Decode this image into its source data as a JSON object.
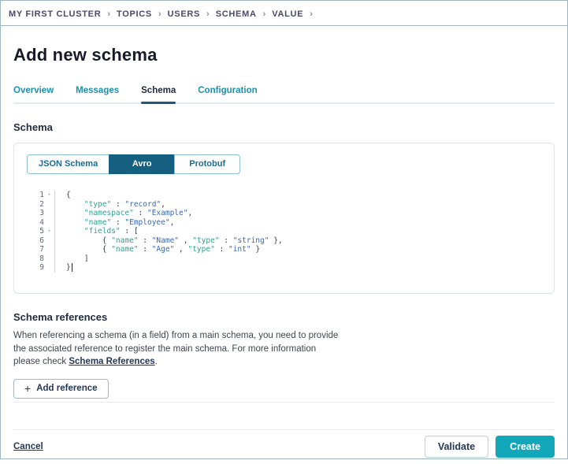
{
  "breadcrumb": {
    "separator": "›",
    "items": [
      "MY FIRST CLUSTER",
      "TOPICS",
      "USERS",
      "SCHEMA",
      "VALUE"
    ]
  },
  "page": {
    "title": "Add new schema"
  },
  "tabs": {
    "items": [
      {
        "label": "Overview",
        "active": false
      },
      {
        "label": "Messages",
        "active": false
      },
      {
        "label": "Schema",
        "active": true
      },
      {
        "label": "Configuration",
        "active": false
      }
    ]
  },
  "schema_section": {
    "heading": "Schema"
  },
  "schema_type_toggle": {
    "options": [
      {
        "label": "JSON Schema",
        "selected": false
      },
      {
        "label": "Avro",
        "selected": true
      },
      {
        "label": "Protobuf",
        "selected": false
      }
    ]
  },
  "editor": {
    "fold_icon": "▾",
    "lines": [
      {
        "num": "1",
        "fold": true,
        "tokens": [
          {
            "t": "{",
            "c": "punc"
          }
        ]
      },
      {
        "num": "2",
        "fold": false,
        "tokens": [
          {
            "t": "    ",
            "c": "punc"
          },
          {
            "t": "\"type\"",
            "c": "key"
          },
          {
            "t": " : ",
            "c": "punc"
          },
          {
            "t": "\"record\"",
            "c": "str"
          },
          {
            "t": ",",
            "c": "punc"
          }
        ]
      },
      {
        "num": "3",
        "fold": false,
        "tokens": [
          {
            "t": "    ",
            "c": "punc"
          },
          {
            "t": "\"namespace\"",
            "c": "key"
          },
          {
            "t": " : ",
            "c": "punc"
          },
          {
            "t": "\"Example\"",
            "c": "str"
          },
          {
            "t": ",",
            "c": "punc"
          }
        ]
      },
      {
        "num": "4",
        "fold": false,
        "tokens": [
          {
            "t": "    ",
            "c": "punc"
          },
          {
            "t": "\"name\"",
            "c": "key"
          },
          {
            "t": " : ",
            "c": "punc"
          },
          {
            "t": "\"Employee\"",
            "c": "str"
          },
          {
            "t": ",",
            "c": "punc"
          }
        ]
      },
      {
        "num": "5",
        "fold": true,
        "tokens": [
          {
            "t": "    ",
            "c": "punc"
          },
          {
            "t": "\"fields\"",
            "c": "key"
          },
          {
            "t": " : [",
            "c": "punc"
          }
        ]
      },
      {
        "num": "6",
        "fold": false,
        "tokens": [
          {
            "t": "        { ",
            "c": "punc"
          },
          {
            "t": "\"name\"",
            "c": "key"
          },
          {
            "t": " : ",
            "c": "punc"
          },
          {
            "t": "\"Name\"",
            "c": "str"
          },
          {
            "t": " , ",
            "c": "punc"
          },
          {
            "t": "\"type\"",
            "c": "key"
          },
          {
            "t": " : ",
            "c": "punc"
          },
          {
            "t": "\"string\"",
            "c": "str"
          },
          {
            "t": " },",
            "c": "punc"
          }
        ]
      },
      {
        "num": "7",
        "fold": false,
        "tokens": [
          {
            "t": "        { ",
            "c": "punc"
          },
          {
            "t": "\"name\"",
            "c": "key"
          },
          {
            "t": " : ",
            "c": "punc"
          },
          {
            "t": "\"Age\"",
            "c": "str"
          },
          {
            "t": " , ",
            "c": "punc"
          },
          {
            "t": "\"type\"",
            "c": "key"
          },
          {
            "t": " : ",
            "c": "punc"
          },
          {
            "t": "\"int\"",
            "c": "str"
          },
          {
            "t": " }",
            "c": "punc"
          }
        ]
      },
      {
        "num": "8",
        "fold": false,
        "tokens": [
          {
            "t": "    ]",
            "c": "punc"
          }
        ]
      },
      {
        "num": "9",
        "fold": false,
        "tokens": [
          {
            "t": "}",
            "c": "punc"
          },
          {
            "t": "",
            "c": "cursor"
          }
        ]
      }
    ]
  },
  "references": {
    "heading": "Schema references",
    "line1": "When referencing a schema (in a field) from a main schema, you need to provide",
    "line2": "the associated reference to register the main schema. For more information",
    "line3_prefix": "please check ",
    "link_label": "Schema References",
    "line3_suffix": ".",
    "add_button_label": "Add reference",
    "plus_icon": "+"
  },
  "footer": {
    "cancel_label": "Cancel",
    "validate_label": "Validate",
    "create_label": "Create"
  },
  "colors": {
    "window_border": "#9fb6c0",
    "breadcrumb_text": "#4a4a66",
    "tab_inactive": "#1d8fb0",
    "tab_active": "#232c42",
    "tab_active_underline": "#1b5a7c",
    "toggle_selected_bg": "#155f80",
    "toggle_text": "#1a6b96",
    "code_key": "#2f9e8f",
    "code_string": "#3a68b0",
    "link_navy": "#253858",
    "create_button_bg": "#13a8b9"
  }
}
